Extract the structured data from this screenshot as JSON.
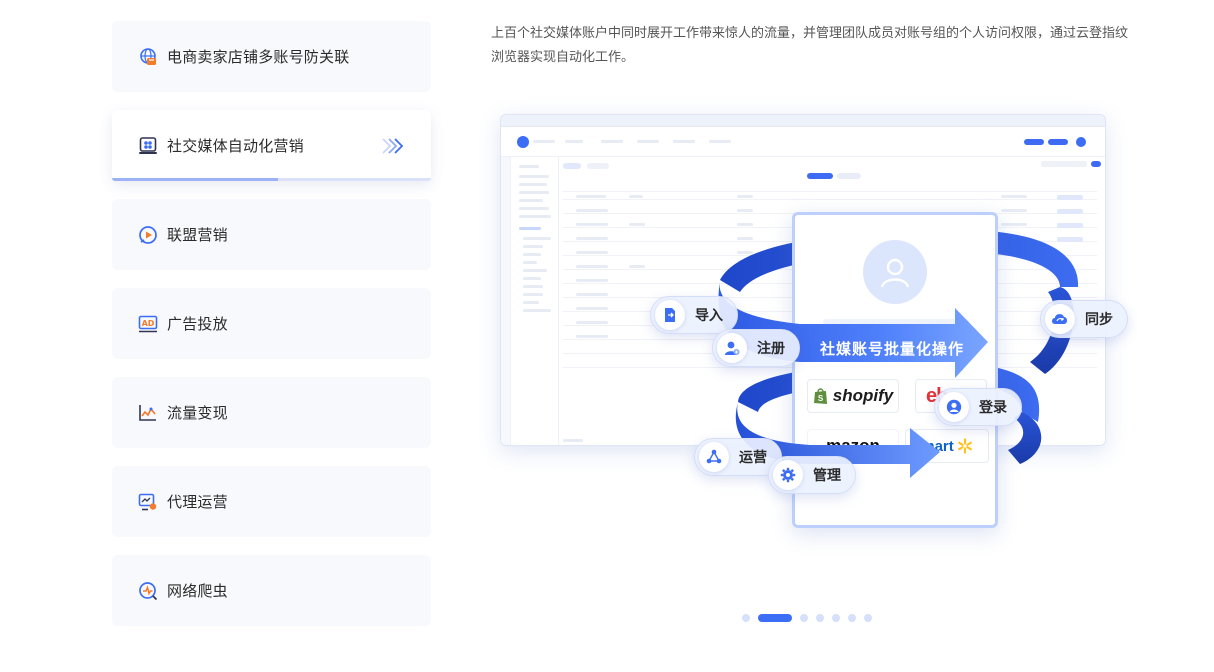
{
  "menu": {
    "items": [
      {
        "label": "电商卖家店铺多账号防关联",
        "icon": "globe-store-icon"
      },
      {
        "label": "社交媒体自动化营销",
        "icon": "social-grid-icon"
      },
      {
        "label": "联盟营销",
        "icon": "play-circle-icon"
      },
      {
        "label": "广告投放",
        "icon": "ad-board-icon"
      },
      {
        "label": "流量变现",
        "icon": "trend-line-icon"
      },
      {
        "label": "代理运营",
        "icon": "agent-monitor-icon"
      },
      {
        "label": "网络爬虫",
        "icon": "spider-search-icon"
      }
    ],
    "active_index": 1,
    "active_progress": 0.52
  },
  "description": "上百个社交媒体账户中同时展开工作带来惊人的流量，并管理团队成员对账号组的个人访问权限，通过云登指纹浏览器实现自动化工作。",
  "illustration": {
    "band_text": "社媒账号批量化操作",
    "chips": {
      "import": "导入",
      "register": "注册",
      "sync": "同步",
      "login": "登录",
      "operate": "运营",
      "manage": "管理"
    },
    "logos": {
      "shopify": "shopify",
      "ebay": "eb",
      "walmart": "mart",
      "amazon": "mazon"
    }
  },
  "carousel": {
    "count": 7,
    "active_index": 1
  },
  "colors": {
    "accent": "#3b6ef5",
    "ribbon_dark": "#2f5de6",
    "ribbon_light": "#6f9bff",
    "menu_bg": "#f8f9fd"
  }
}
